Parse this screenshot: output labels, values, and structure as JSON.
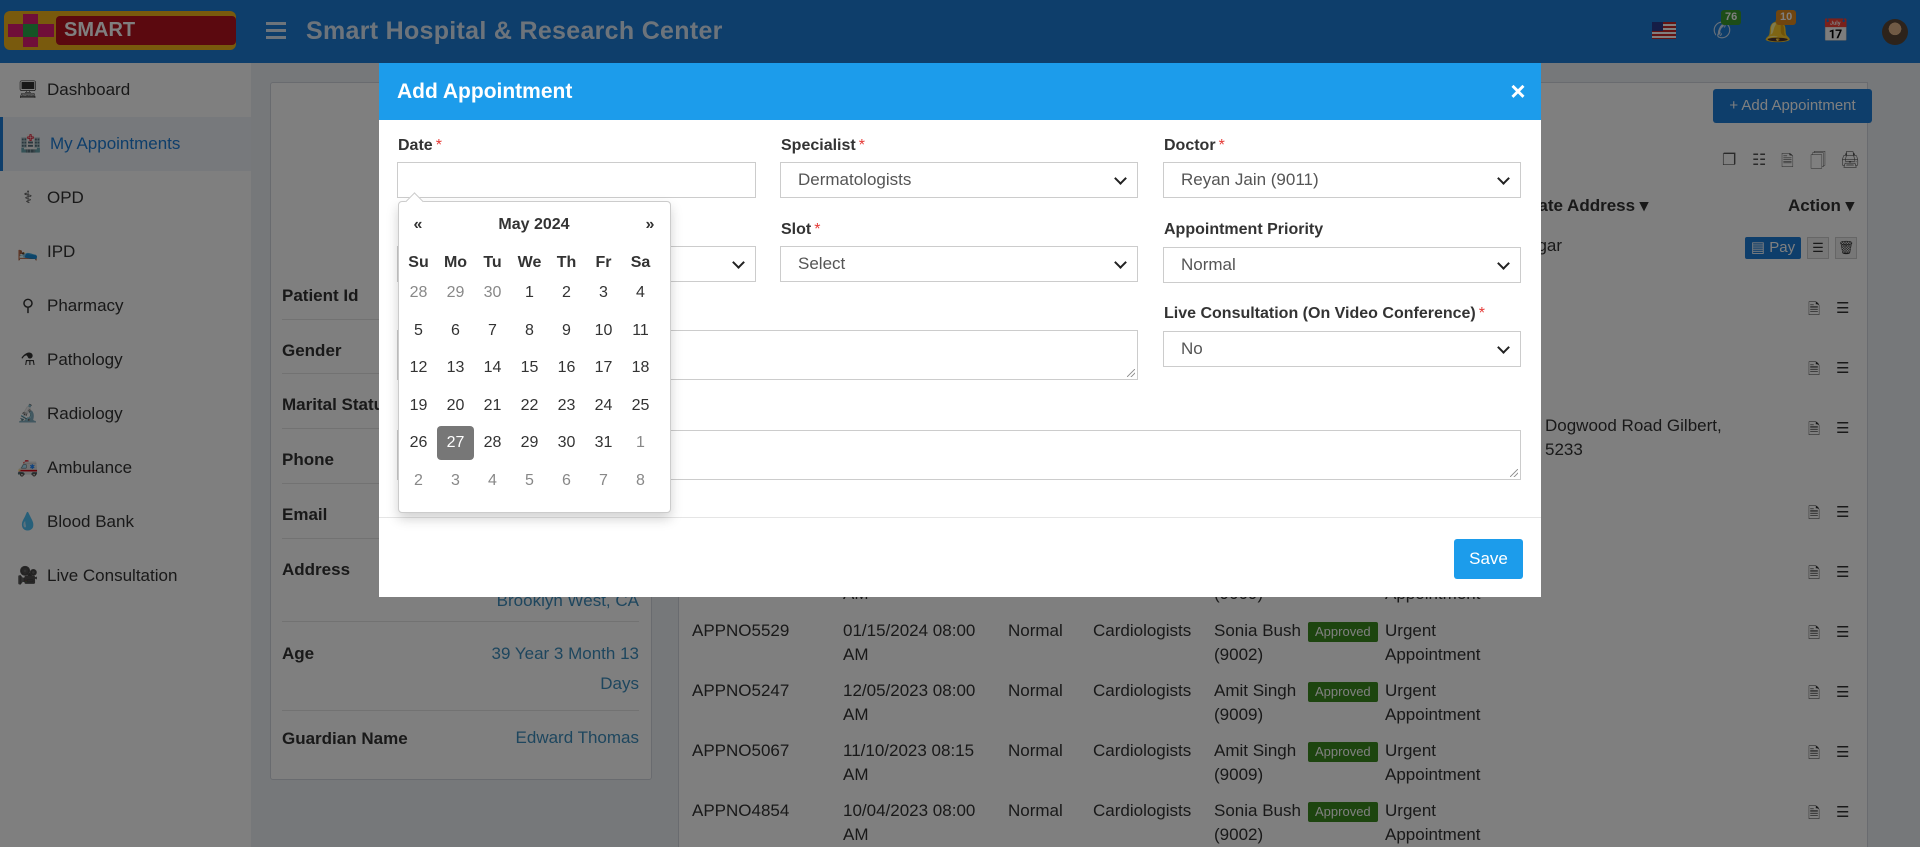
{
  "header": {
    "logo_text": "SMART HOSPITAL",
    "title": "Smart Hospital & Research Center",
    "whatsapp_badge": "76",
    "notifications_badge": "10"
  },
  "sidebar": {
    "items": [
      {
        "label": "Dashboard",
        "icon": "desktop-icon"
      },
      {
        "label": "My Appointments",
        "icon": "hospital-icon"
      },
      {
        "label": "OPD",
        "icon": "stethoscope-icon"
      },
      {
        "label": "IPD",
        "icon": "bed-icon"
      },
      {
        "label": "Pharmacy",
        "icon": "mortar-pestle-icon"
      },
      {
        "label": "Pathology",
        "icon": "flask-icon"
      },
      {
        "label": "Radiology",
        "icon": "microscope-icon"
      },
      {
        "label": "Ambulance",
        "icon": "ambulance-icon"
      },
      {
        "label": "Blood Bank",
        "icon": "blood-drop-icon"
      },
      {
        "label": "Live Consultation",
        "icon": "video-camera-icon"
      }
    ]
  },
  "profile": {
    "labels": [
      "Patient Id",
      "Gender",
      "Marital Status",
      "Phone",
      "Email",
      "Address",
      "Age",
      "Guardian Name"
    ],
    "address_tail": "Brooklyn West, CA",
    "age_line1": "39 Year 3 Month 13",
    "age_line2": "Days",
    "guardian": "Edward Thomas"
  },
  "list": {
    "add_button": "Add Appointment",
    "headers": {
      "alt_address": "nate Address",
      "action": "Action"
    },
    "first_row_address": "agar",
    "address_line1": "Dogwood Road Gilbert,",
    "address_line2": "5233",
    "pay_label": "Pay",
    "approved_label": "Approved",
    "partial_doctor": "(9009)",
    "partial_time": "AM",
    "partial_type": "Appointment",
    "rows": [
      {
        "id": "APPNO5529",
        "date1": "01/15/2024 08:00",
        "date2": "AM",
        "priority": "Normal",
        "spec": "Cardiologists",
        "doc1": "Sonia Bush",
        "doc2": "(9002)",
        "type1": "Urgent",
        "type2": "Appointment"
      },
      {
        "id": "APPNO5247",
        "date1": "12/05/2023 08:00",
        "date2": "AM",
        "priority": "Normal",
        "spec": "Cardiologists",
        "doc1": "Amit Singh",
        "doc2": "(9009)",
        "type1": "Urgent",
        "type2": "Appointment"
      },
      {
        "id": "APPNO5067",
        "date1": "11/10/2023 08:15",
        "date2": "AM",
        "priority": "Normal",
        "spec": "Cardiologists",
        "doc1": "Amit Singh",
        "doc2": "(9009)",
        "type1": "Urgent",
        "type2": "Appointment"
      },
      {
        "id": "APPNO4854",
        "date1": "10/04/2023 08:00",
        "date2": "AM",
        "priority": "Normal",
        "spec": "Cardiologists",
        "doc1": "Sonia Bush",
        "doc2": "(9002)",
        "type1": "Urgent",
        "type2": "Appointment"
      }
    ]
  },
  "modal": {
    "title": "Add Appointment",
    "date_label": "Date",
    "date_value": "",
    "specialist_label": "Specialist",
    "specialist_value": "Dermatologists",
    "doctor_label": "Doctor",
    "doctor_value": "Reyan Jain (9011)",
    "slot_label": "Slot",
    "slot_value": "Select",
    "priority_label": "Appointment Priority",
    "priority_value": "Normal",
    "live_label": "Live Consultation (On Video Conference)",
    "live_value": "No",
    "required_mark": "*",
    "save_label": "Save"
  },
  "datepicker": {
    "title": "May 2024",
    "prev": "«",
    "next": "»",
    "weekdays": [
      "Su",
      "Mo",
      "Tu",
      "We",
      "Th",
      "Fr",
      "Sa"
    ],
    "weeks": [
      [
        "28",
        "29",
        "30",
        "1",
        "2",
        "3",
        "4"
      ],
      [
        "5",
        "6",
        "7",
        "8",
        "9",
        "10",
        "11"
      ],
      [
        "12",
        "13",
        "14",
        "15",
        "16",
        "17",
        "18"
      ],
      [
        "19",
        "20",
        "21",
        "22",
        "23",
        "24",
        "25"
      ],
      [
        "26",
        "27",
        "28",
        "29",
        "30",
        "31",
        "1"
      ],
      [
        "2",
        "3",
        "4",
        "5",
        "6",
        "7",
        "8"
      ]
    ],
    "selected": "27"
  },
  "colors": {
    "header": "#1c7cd6",
    "modal_header": "#1c9ceb",
    "approved": "#3a8a1e"
  }
}
